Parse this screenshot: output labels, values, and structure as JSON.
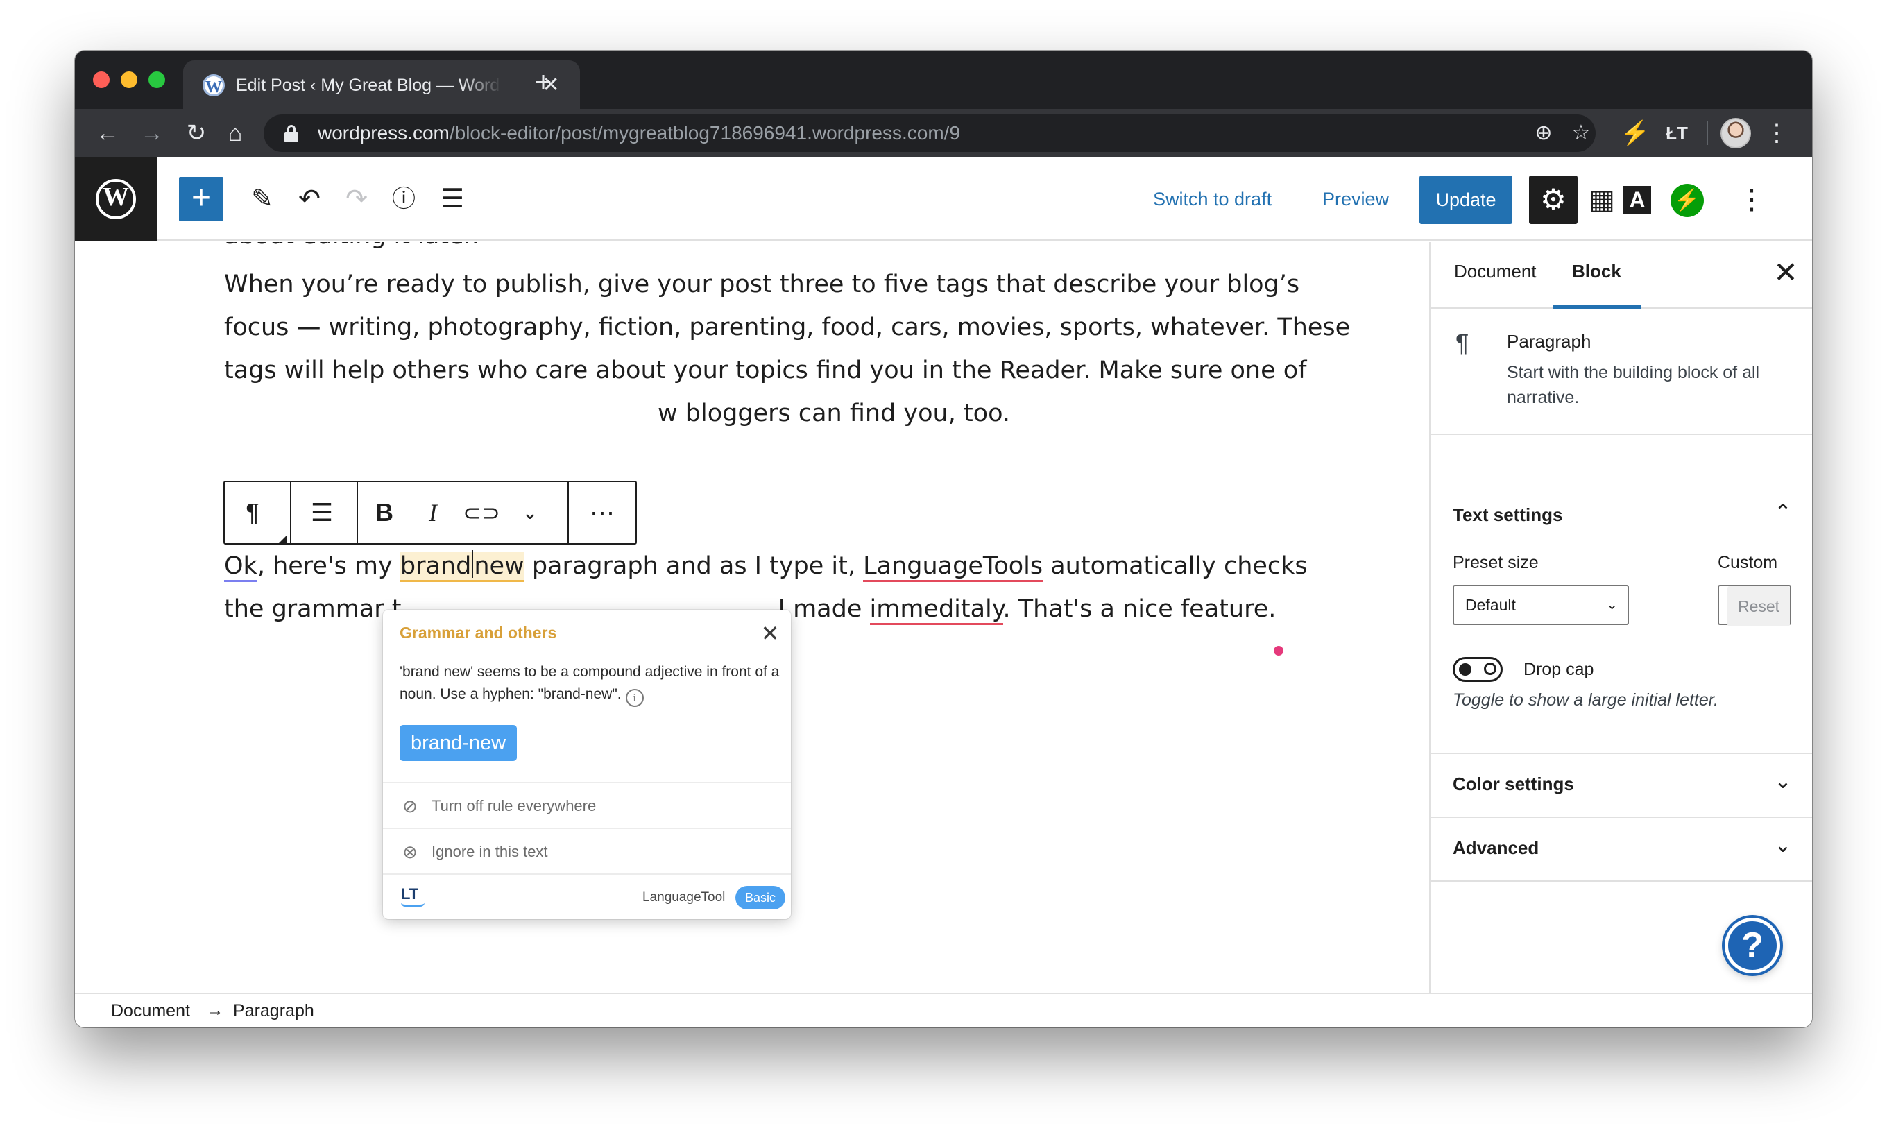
{
  "browser": {
    "tab_title": "Edit Post ‹ My Great Blog — WordPress.com",
    "favicon": "W",
    "tab_close": "✕",
    "new_tab": "+",
    "url_host": "wordpress.com",
    "url_path": "/block-editor/post/mygreatblog718696941.wordpress.com/9",
    "icons": [
      "back-icon",
      "forward-icon",
      "reload-icon",
      "home-icon",
      "lock-icon",
      "add-icon",
      "star-icon",
      "extension-icon",
      "languagetool-icon",
      "menu-icon"
    ]
  },
  "editor_header": {
    "logo": "W",
    "add_block": "+",
    "switch_to_draft": "Switch to draft",
    "preview": "Preview",
    "update": "Update"
  },
  "content": {
    "partial_line": "about editing it later.",
    "para1_lines": [
      "When you’re ready to publish, give your post three to five tags that describe your blog’s",
      "focus — writing, photography, fiction, parenting, food, cars, movies, sports, whatever. These",
      "tags will help others who care about your topics find you in the Reader. Make sure one of",
      "w bloggers can find you, too."
    ],
    "para2": {
      "ok": "Ok",
      "seg1": ", here's my ",
      "brand": "brand",
      "new": "new",
      "seg2": " paragraph and as I type it, ",
      "languagetools": "LanguageTools",
      "seg3": " automatically checks",
      "line2_start": "the grammar t",
      "line2_mid": " I made ",
      "immeditaly": "immeditaly",
      "line2_end": ". That's a nice feature."
    }
  },
  "block_toolbar": {
    "paragraph": "¶",
    "bold": "B",
    "italic": "I",
    "more": "⋯"
  },
  "languagetool_popup": {
    "category": "Grammar and others",
    "message": "'brand new' seems to be a compound adjective in front of a noun. Use a hyphen: \"brand-new\".",
    "suggestion": "brand-new",
    "turn_off": "Turn off rule everywhere",
    "ignore": "Ignore in this text",
    "logo": "LT",
    "brand": "LanguageTool",
    "plan": "Basic"
  },
  "sidebar": {
    "tabs": [
      "Document",
      "Block"
    ],
    "active_tab": "Block",
    "block_title": "Paragraph",
    "block_desc": "Start with the building block of all narrative.",
    "text_settings": "Text settings",
    "preset_size_label": "Preset size",
    "preset_size_value": "Default",
    "custom_label": "Custom",
    "custom_value": "",
    "reset": "Reset",
    "drop_cap": "Drop cap",
    "drop_cap_help": "Toggle to show a large initial letter.",
    "drop_cap_enabled": false,
    "color_settings": "Color settings",
    "advanced": "Advanced"
  },
  "footer": {
    "breadcrumb": [
      "Document",
      "Paragraph"
    ]
  },
  "colors": {
    "wp_blue": "#2271b1",
    "lt_blue": "#4ba1f0",
    "lt_yellow": "#d8a039",
    "error_red": "#e34a5c",
    "style_purple": "#7b7ff0"
  }
}
